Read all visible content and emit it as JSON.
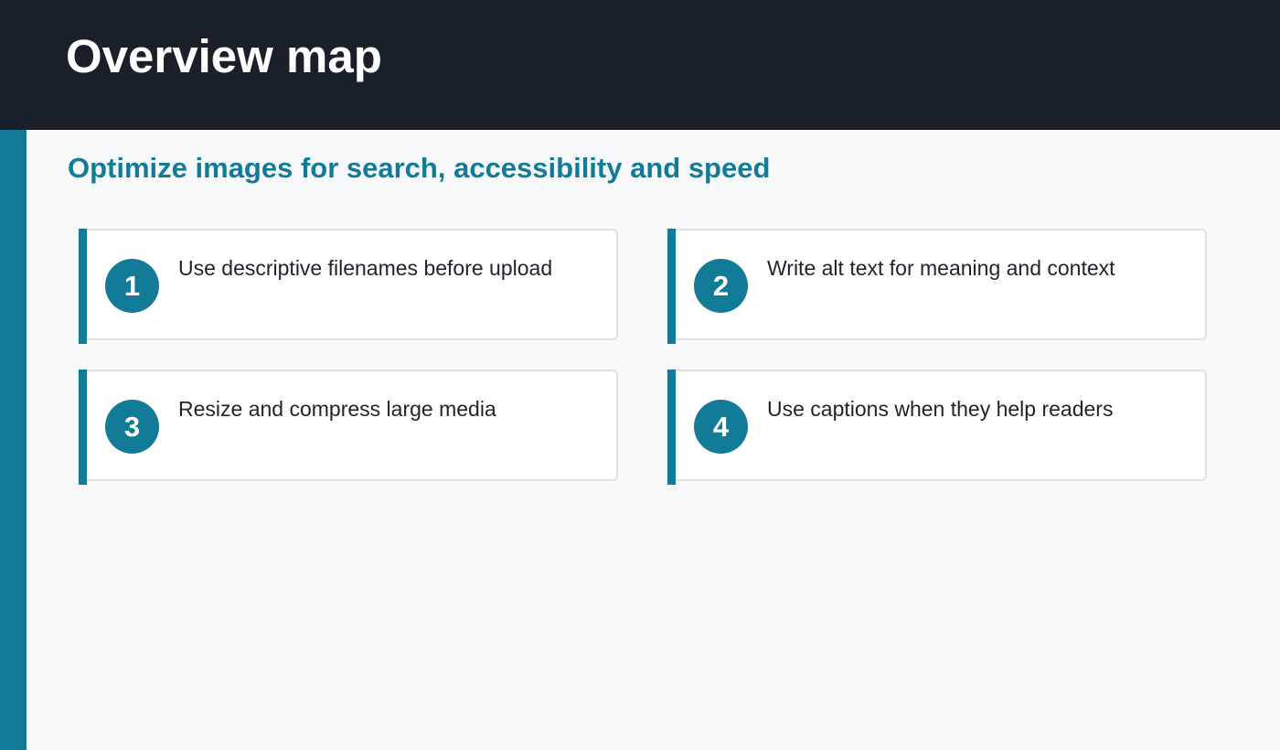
{
  "header": {
    "title": "Overview map"
  },
  "subtitle": "Optimize images for search, accessibility and speed",
  "cards": [
    {
      "number": "1",
      "text": "Use descriptive filenames before upload"
    },
    {
      "number": "2",
      "text": "Write alt text for meaning and context"
    },
    {
      "number": "3",
      "text": "Resize and compress large media"
    },
    {
      "number": "4",
      "text": "Use captions when they help readers"
    }
  ],
  "colors": {
    "header_bg": "#1a202a",
    "accent": "#127c98",
    "page_bg": "#f8f9fb",
    "card_border": "#dde1e6",
    "text": "#1f242b"
  }
}
